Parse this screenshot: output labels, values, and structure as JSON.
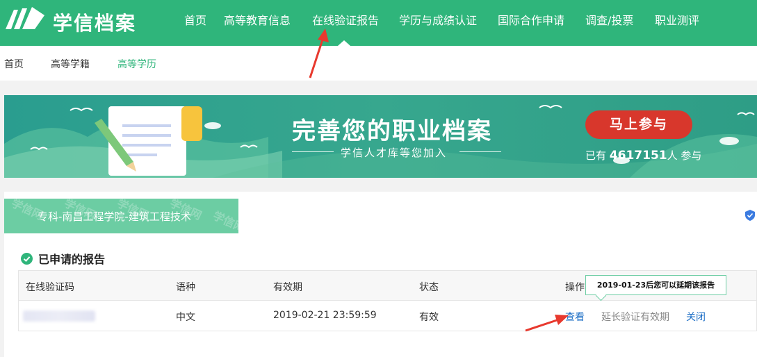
{
  "brand": {
    "name": "学信档案"
  },
  "nav": {
    "items": [
      {
        "label": "首页"
      },
      {
        "label": "高等教育信息"
      },
      {
        "label": "在线验证报告"
      },
      {
        "label": "学历与成绩认证"
      },
      {
        "label": "国际合作申请"
      },
      {
        "label": "调查/投票"
      },
      {
        "label": "职业测评"
      }
    ]
  },
  "subnav": {
    "items": [
      {
        "label": "首页"
      },
      {
        "label": "高等学籍"
      },
      {
        "label": "高等学历"
      }
    ]
  },
  "banner": {
    "title": "完善您的职业档案",
    "subtitle": "学信人才库等您加入",
    "button_label": "马上参与",
    "count_prefix": "已有",
    "count": "4617151",
    "count_suffix": "人 参与"
  },
  "school": {
    "label": "专科-南昌工程学院-建筑工程技术",
    "watermark": "学信网"
  },
  "reports": {
    "section_title": "已申请的报告",
    "columns": [
      "在线验证码",
      "语种",
      "有效期",
      "状态",
      "操作"
    ],
    "rows": [
      {
        "language": "中文",
        "valid_until": "2019-02-21 23:59:59",
        "status": "有效",
        "actions": {
          "view": "查看",
          "extend": "延长验证有效期",
          "close": "关闭"
        }
      }
    ],
    "tooltip": "2019-01-23后您可以延期该报告"
  },
  "colors": {
    "primary": "#2fb57b",
    "accent": "#d8372c",
    "link": "#1e6fc6",
    "arrow": "#e8392e"
  }
}
